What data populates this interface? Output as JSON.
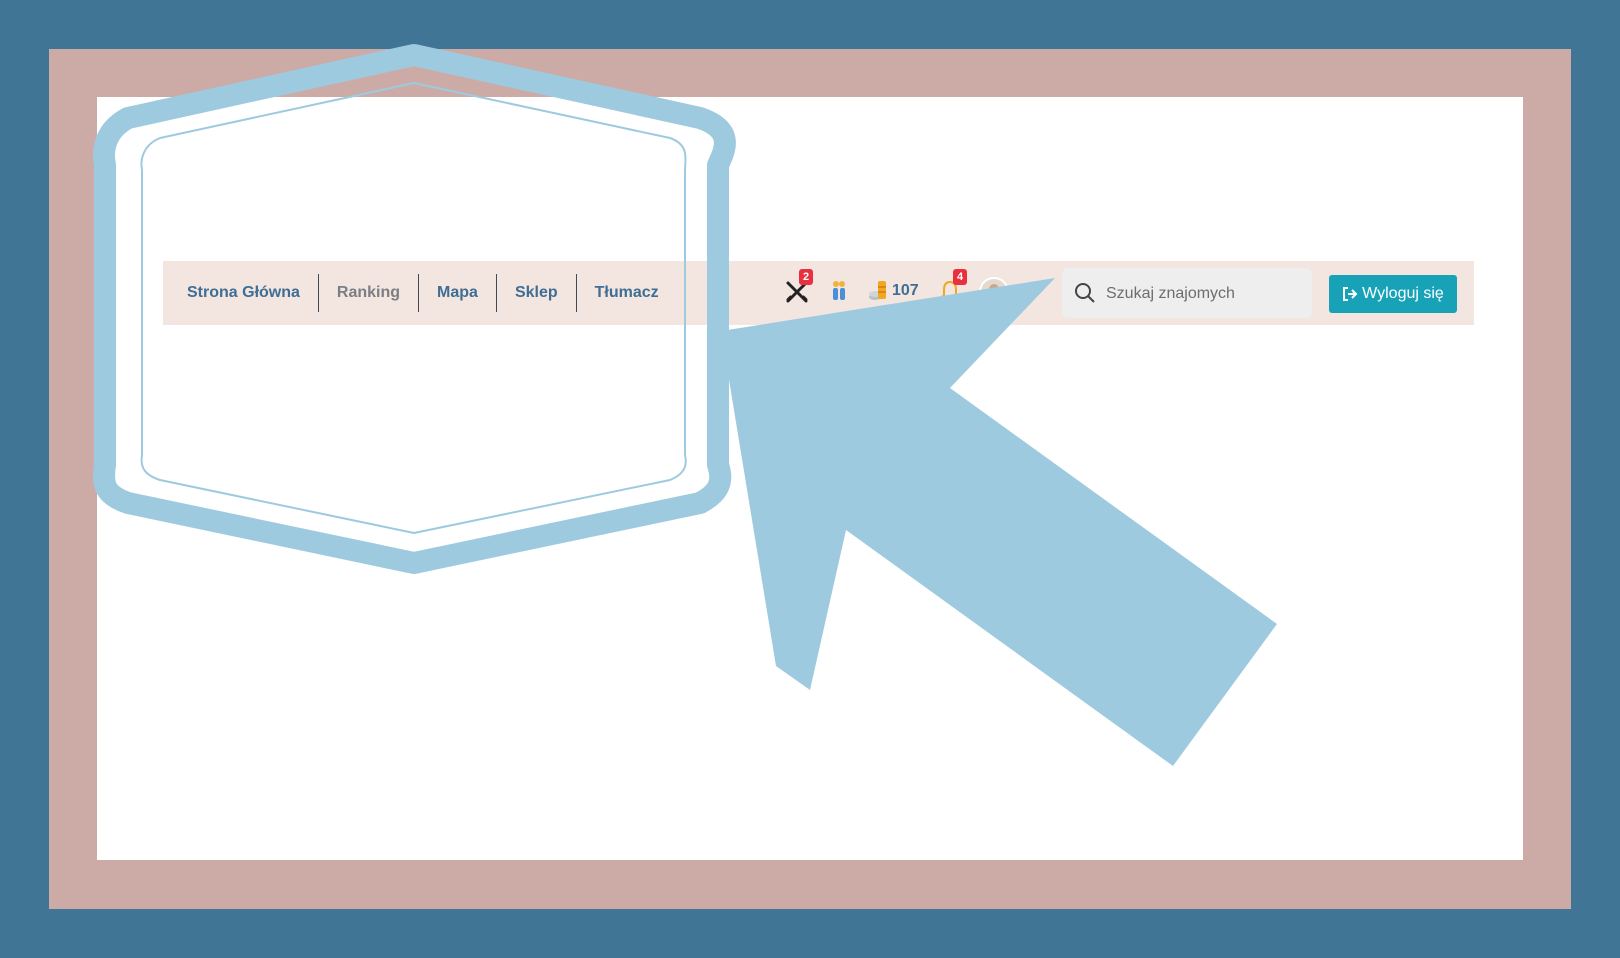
{
  "nav": {
    "items": [
      {
        "label": "Strona Główna"
      },
      {
        "label": "Ranking"
      },
      {
        "label": "Mapa"
      },
      {
        "label": "Sklep"
      },
      {
        "label": "Tłumacz"
      }
    ]
  },
  "status": {
    "battles_badge": "2",
    "coins": "107",
    "notifications_badge": "4"
  },
  "search": {
    "placeholder": "Szukaj znajomych"
  },
  "logout": {
    "label": "Wyloguj się"
  },
  "colors": {
    "background": "#417596",
    "frame": "#ccaba6",
    "navbar": "#f3e5df",
    "link": "#3f6e95",
    "button": "#17a2b8",
    "badge": "#e8303f",
    "annotation": "#9ecadf"
  }
}
